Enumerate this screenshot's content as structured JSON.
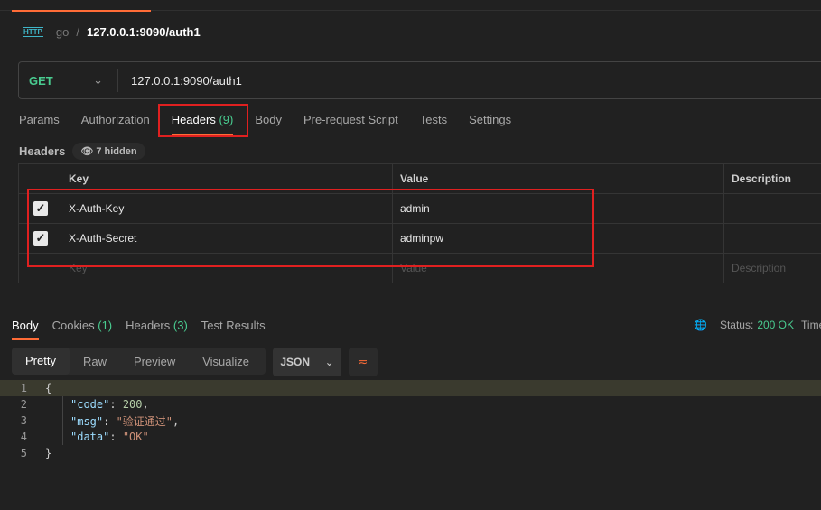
{
  "breadcrumb": {
    "icon": "http-icon",
    "icon_text": "HTTP",
    "collection": "go",
    "separator": "/",
    "request": "127.0.0.1:9090/auth1"
  },
  "request": {
    "method": "GET",
    "url": "127.0.0.1:9090/auth1"
  },
  "tabs": [
    {
      "label": "Params"
    },
    {
      "label": "Authorization"
    },
    {
      "label": "Headers",
      "count": "(9)"
    },
    {
      "label": "Body"
    },
    {
      "label": "Pre-request Script"
    },
    {
      "label": "Tests"
    },
    {
      "label": "Settings"
    }
  ],
  "headers": {
    "title": "Headers",
    "hidden": "7 hidden",
    "columns": [
      "Key",
      "Value",
      "Description"
    ],
    "rows": [
      {
        "key": "X-Auth-Key",
        "value": "admin",
        "checked": true
      },
      {
        "key": "X-Auth-Secret",
        "value": "adminpw",
        "checked": true
      }
    ],
    "placeholder": {
      "key": "Key",
      "value": "Value",
      "description": "Description"
    }
  },
  "response": {
    "tabs": [
      {
        "label": "Body"
      },
      {
        "label": "Cookies",
        "count": "(1)"
      },
      {
        "label": "Headers",
        "count": "(3)"
      },
      {
        "label": "Test Results"
      }
    ],
    "status_label": "Status:",
    "status": "200 OK",
    "time_label": "Time",
    "views": [
      "Pretty",
      "Raw",
      "Preview",
      "Visualize"
    ],
    "format": "JSON",
    "lines": [
      "1",
      "2",
      "3",
      "4",
      "5"
    ],
    "body": {
      "open": "{",
      "code_key": "\"code\"",
      "code_val": "200",
      "msg_key": "\"msg\"",
      "msg_val": "\"验证通过\"",
      "data_key": "\"data\"",
      "data_val": "\"OK\"",
      "close": "}"
    }
  },
  "colors": {
    "accent": "#ff6c37",
    "get": "#49cc90",
    "highlight": "#e02020"
  }
}
